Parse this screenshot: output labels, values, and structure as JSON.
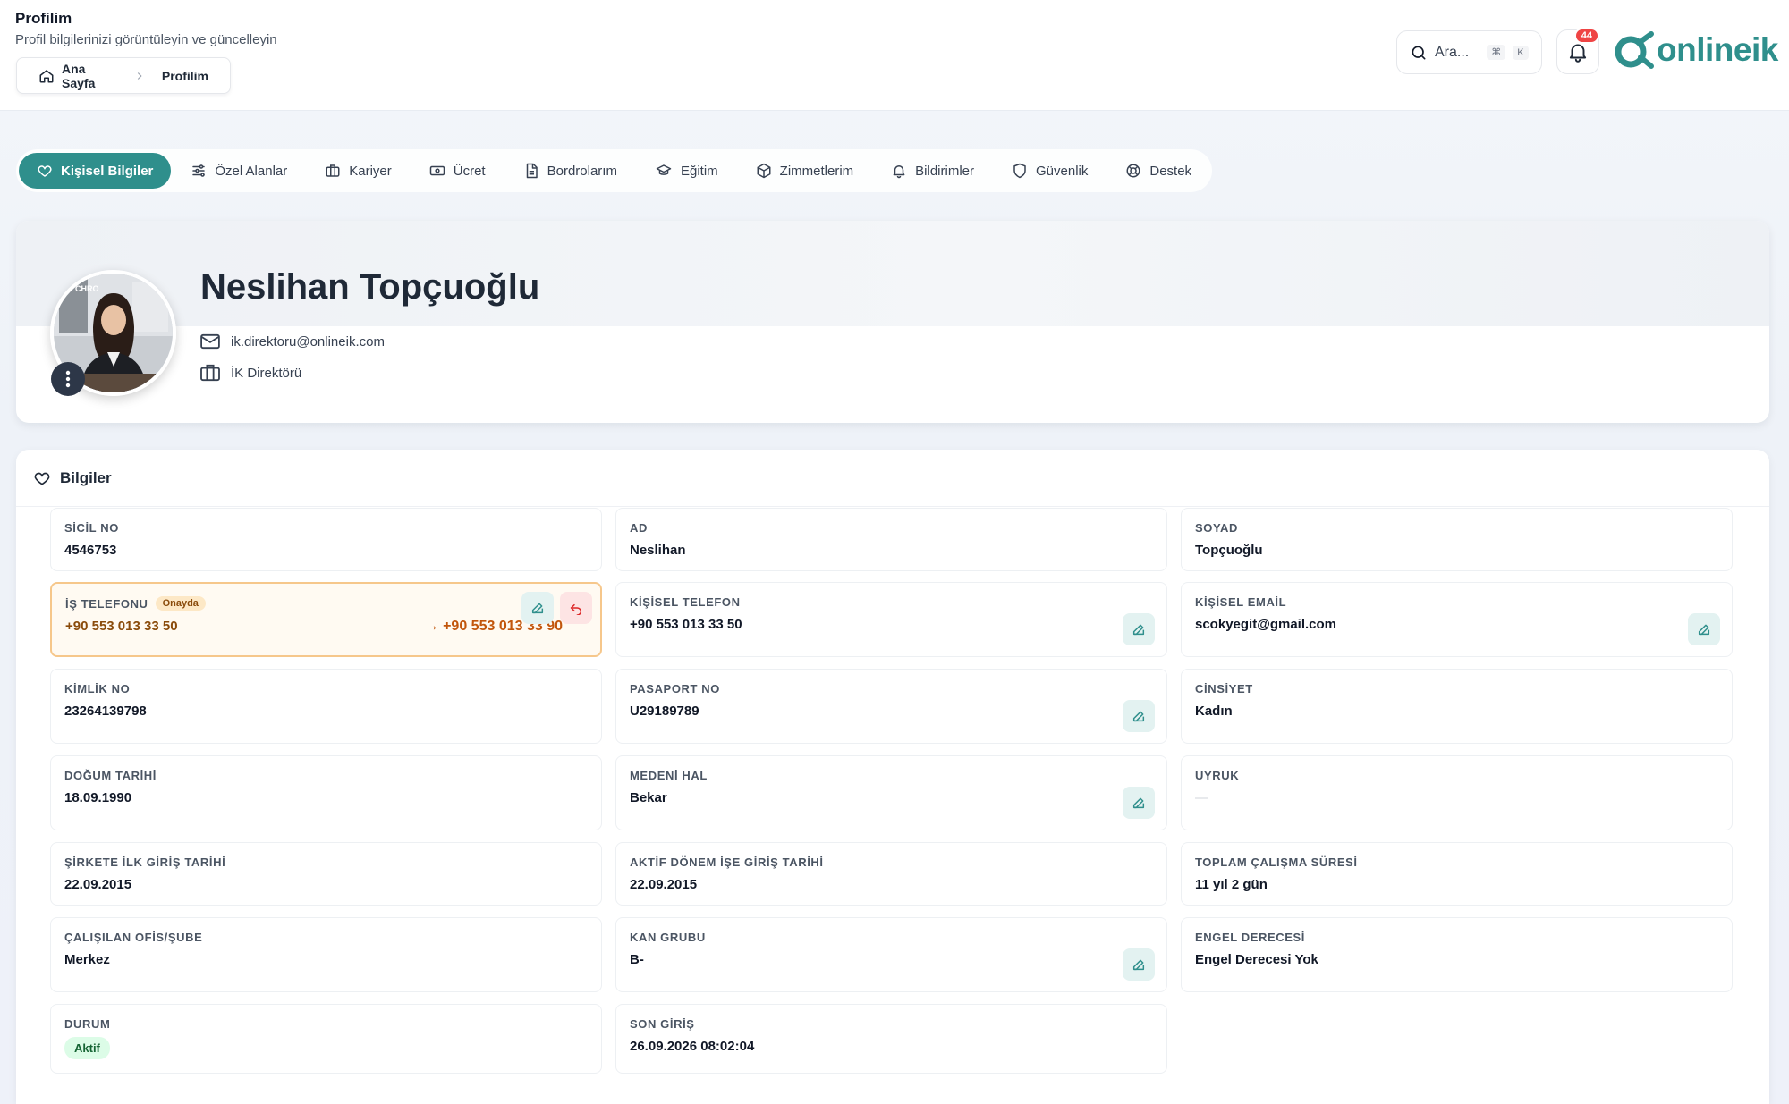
{
  "header": {
    "title": "Profilim",
    "subtitle": "Profil bilgilerinizi görüntüleyin ve güncelleyin",
    "breadcrumb": {
      "home": "Ana Sayfa",
      "current": "Profilim"
    },
    "search": {
      "placeholder": "Ara...",
      "shortcut_cmd": "⌘",
      "shortcut_key": "K"
    },
    "notifications_count": "44",
    "logo_text": "onlineik"
  },
  "tabs": [
    {
      "label": "Kişisel Bilgiler",
      "icon": "heart-icon",
      "active": true
    },
    {
      "label": "Özel Alanlar",
      "icon": "sliders-icon"
    },
    {
      "label": "Kariyer",
      "icon": "briefcase-icon"
    },
    {
      "label": "Ücret",
      "icon": "banknote-icon"
    },
    {
      "label": "Bordrolarım",
      "icon": "document-icon"
    },
    {
      "label": "Eğitim",
      "icon": "graduation-cap-icon"
    },
    {
      "label": "Zimmetlerim",
      "icon": "package-icon"
    },
    {
      "label": "Bildirimler",
      "icon": "bell-icon"
    },
    {
      "label": "Güvenlik",
      "icon": "shield-icon"
    },
    {
      "label": "Destek",
      "icon": "lifebuoy-icon"
    }
  ],
  "profile": {
    "name": "Neslihan Topçuoğlu",
    "email": "ik.direktoru@onlineik.com",
    "role": "İK Direktörü",
    "avatar_sign": "CHRO"
  },
  "info": {
    "section_title": "Bilgiler",
    "fields": {
      "sicil_no": {
        "label": "SİCİL NO",
        "value": "4546753"
      },
      "ad": {
        "label": "AD",
        "value": "Neslihan"
      },
      "soyad": {
        "label": "SOYAD",
        "value": "Topçuoğlu"
      },
      "is_telefonu": {
        "label": "İŞ TELEFONU",
        "badge": "Onayda",
        "old_value": "+90 553 013 33 50",
        "new_value": "→ +90 553 013 33 90"
      },
      "kisisel_telefon": {
        "label": "KİŞİSEL TELEFON",
        "value": "+90 553 013 33 50"
      },
      "kisisel_email": {
        "label": "KİŞİSEL EMAİL",
        "value": "scokyegit@gmail.com"
      },
      "kimlik_no": {
        "label": "KİMLİK NO",
        "value": "23264139798"
      },
      "pasaport_no": {
        "label": "PASAPORT NO",
        "value": "U29189789"
      },
      "cinsiyet": {
        "label": "CİNSİYET",
        "value": "Kadın"
      },
      "dogum_tarihi": {
        "label": "DOĞUM TARİHİ",
        "value": "18.09.1990"
      },
      "medeni_hal": {
        "label": "MEDENİ HAL",
        "value": "Bekar"
      },
      "uyruk": {
        "label": "UYRUK",
        "value": "—"
      },
      "ilk_giris": {
        "label": "ŞİRKETE İLK GİRİŞ TARİHİ",
        "value": "22.09.2015"
      },
      "aktif_donem": {
        "label": "AKTİF DÖNEM İŞE GİRİŞ TARİHİ",
        "value": "22.09.2015"
      },
      "toplam_sure": {
        "label": "TOPLAM ÇALIŞMA SÜRESİ",
        "value": "11 yıl 2 gün"
      },
      "ofis": {
        "label": "ÇALIŞILAN OFİS/ŞUBE",
        "value": "Merkez"
      },
      "kan_grubu": {
        "label": "KAN GRUBU",
        "value": "B-"
      },
      "engel": {
        "label": "ENGEL DERECESİ",
        "value": "Engel Derecesi Yok"
      },
      "durum": {
        "label": "DURUM",
        "value": "Aktif"
      },
      "son_giris": {
        "label": "SON GİRİŞ",
        "value": "26.09.2026 08:02:04"
      }
    }
  },
  "colors": {
    "accent": "#2f8f8c",
    "pending_border": "#f6c78b",
    "pending_text": "#c2560c",
    "badge_red": "#ef4444",
    "status_green": "#dcfce7"
  }
}
